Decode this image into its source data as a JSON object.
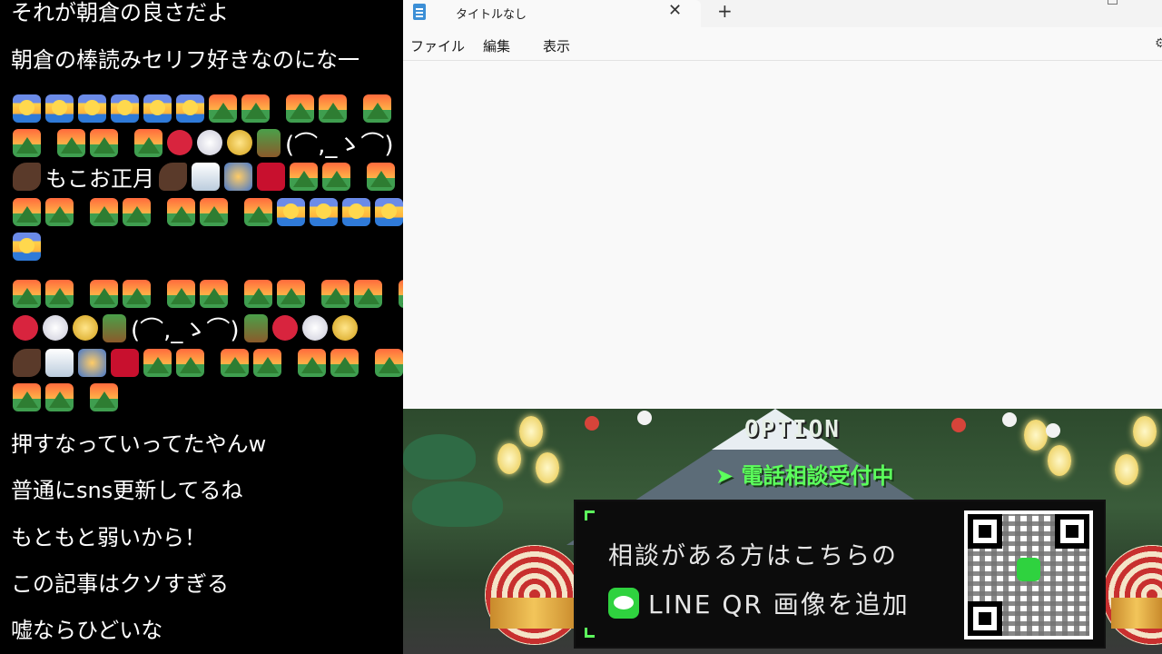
{
  "chat": {
    "messages_top": [
      "それが朝倉の良さだよ",
      "朝倉の棒読みセリフ好きなのにな一"
    ],
    "emoji_block1": {
      "kaomoji": "(⌒,_ゝ⌒)",
      "text": "もこお正月"
    },
    "emoji_block2": {
      "kaomoji": "(⌒,_ゝ⌒)"
    },
    "messages_bottom": [
      "押すなっていってたやんw",
      "普通にsns更新してるね",
      "もともと弱いから！",
      "この記事はクソすぎる",
      "嘘ならひどいな"
    ],
    "colors": {
      "bg": "#000000",
      "text": "#ffffff"
    }
  },
  "notepad": {
    "tab_title": "タイトルなし",
    "tab_close": "✕",
    "tab_add": "+",
    "menu": [
      "ファイル",
      "編集",
      "表示"
    ],
    "settings_glyph": "⚙"
  },
  "ad": {
    "option": "OPTION",
    "phone": "➤ 電話相談受付中",
    "line1": "相談がある方はこちらの",
    "line2": "LINE QR 画像を追加",
    "accent": "#5cff5c"
  }
}
